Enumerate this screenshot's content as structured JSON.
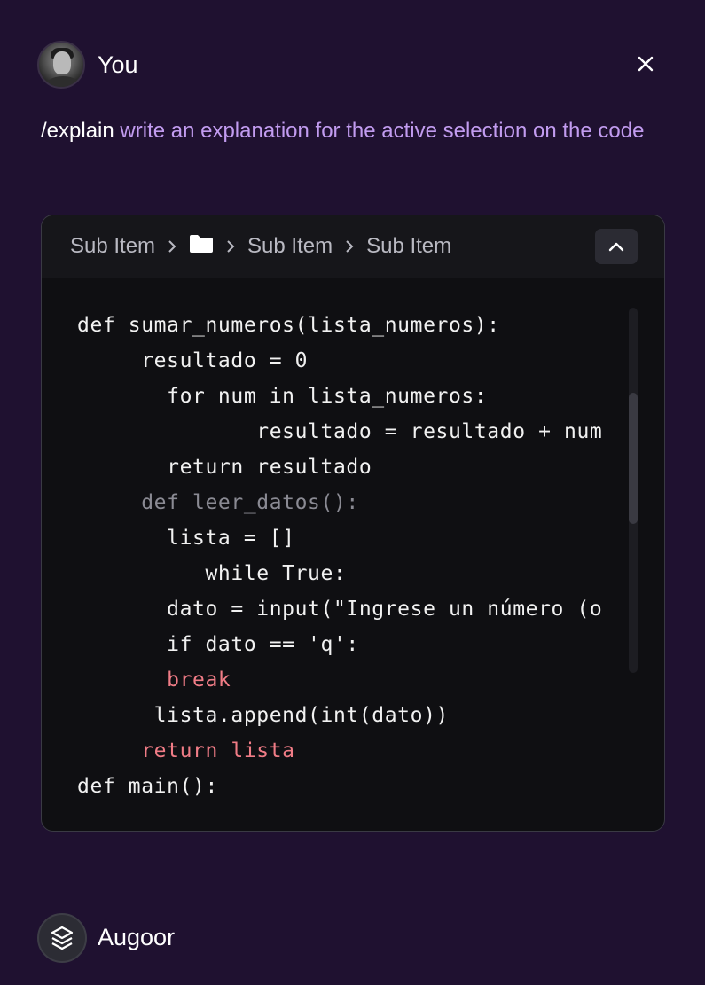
{
  "header": {
    "user_name": "You",
    "avatar_icon": "user-avatar",
    "close_icon": "close-icon"
  },
  "prompt": {
    "command": "/explain",
    "text": "write an explanation for the active selection on the code"
  },
  "code_card": {
    "breadcrumbs": [
      "Sub Item",
      "folder-icon",
      "Sub Item",
      "Sub Item"
    ],
    "crumb_labels": {
      "first": "Sub Item",
      "third": "Sub Item",
      "fourth": "Sub Item"
    },
    "collapse_icon": "chevron-up-icon",
    "lines": [
      "def sumar_numeros(lista_numeros):",
      "     resultado = 0",
      "       for num in lista_numeros:",
      "              resultado = resultado + num",
      "       return resultado",
      "     def leer_datos():",
      "       lista = []",
      "          while True:",
      "       dato = input(\"Ingrese un número (o",
      "       if dato == 'q':",
      "       break",
      "      lista.append(int(dato))",
      "     return lista",
      "def main():"
    ],
    "colors": {
      "default": "#f1f1f1",
      "dim": "#8a8a93",
      "keyword": "#f07c86"
    }
  },
  "assistant": {
    "name": "Augoor",
    "logo_icon": "augoor-logo-icon"
  },
  "theme": {
    "background": "#1f1130",
    "prompt_accent": "#c29cf0"
  }
}
